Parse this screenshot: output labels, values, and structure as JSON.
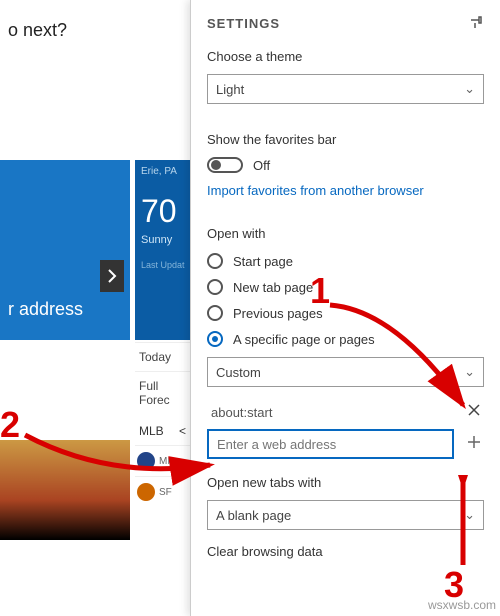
{
  "background": {
    "title_fragment": "o next?",
    "blue_card_text": "r address",
    "weather": {
      "location": "Erie, PA",
      "temp": "70",
      "condition": "Sunny",
      "last_update": "Last Updat"
    },
    "mid_links": {
      "today": "Today",
      "forecast": "Full Forec"
    },
    "sports_header": "MLB",
    "teams": {
      "mil": "MIL",
      "sf": "SF"
    }
  },
  "settings": {
    "header": "SETTINGS",
    "theme_label": "Choose a theme",
    "theme_value": "Light",
    "favbar_label": "Show the favorites bar",
    "favbar_state": "Off",
    "import_link": "Import favorites from another browser",
    "openwith_label": "Open with",
    "openwith_options": {
      "start": "Start page",
      "newtab": "New tab page",
      "previous": "Previous pages",
      "specific": "A specific page or pages"
    },
    "custom_select": "Custom",
    "page_entry": "about:start",
    "url_placeholder": "Enter a web address",
    "newtabs_label": "Open new tabs with",
    "newtabs_value": "A blank page",
    "clear_label": "Clear browsing data"
  },
  "annotations": {
    "n1": "1",
    "n2": "2",
    "n3": "3"
  },
  "watermark": "wsxwsb.com"
}
